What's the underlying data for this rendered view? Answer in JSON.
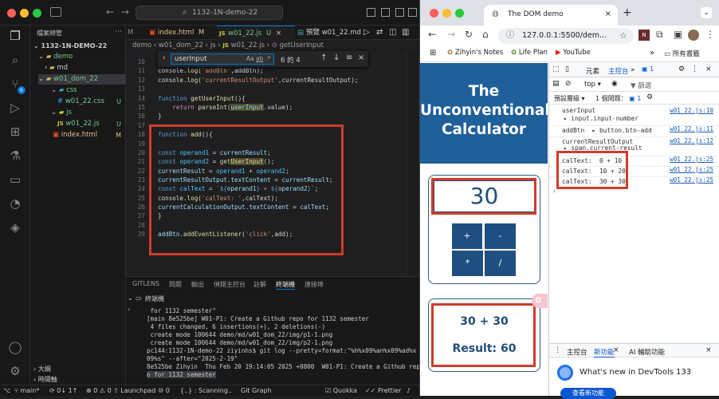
{
  "vscode": {
    "command_center": "1132-1N-demo-22",
    "explorer": {
      "title": "檔案總管",
      "root": "1132-1N-DEMO-22",
      "items": [
        {
          "label": "demo",
          "status": "",
          "kind": "folder"
        },
        {
          "label": "md",
          "status": "",
          "kind": "folder"
        },
        {
          "label": "w01_dom_22",
          "status": "",
          "kind": "folder"
        },
        {
          "label": "css",
          "status": "",
          "kind": "folder"
        },
        {
          "label": "w01_22.css",
          "status": "U",
          "kind": "file"
        },
        {
          "label": "js",
          "status": "",
          "kind": "folder"
        },
        {
          "label": "w01_22.js",
          "status": "U",
          "kind": "file"
        },
        {
          "label": "index.html",
          "status": "M",
          "kind": "file"
        }
      ],
      "outline": "大綱",
      "timeline": "時間軸"
    },
    "tabs": [
      {
        "label": "index.html",
        "status": "M"
      },
      {
        "label": "w01_22.js",
        "status": "U"
      },
      {
        "label": "預覽 w01_22.md",
        "status": ""
      }
    ],
    "breadcrumb": [
      "demo",
      "w01_dom_22",
      "js",
      "w01_22.js",
      "getUserInput"
    ],
    "find": {
      "query": "userInput",
      "opt_case": "Aa",
      "opt_word": "ab",
      "opt_regex": ".*",
      "count": "6 的 4"
    },
    "code_lines": [
      {
        "n": "10",
        "text": "console.log('addBtn',addBtn);"
      },
      {
        "n": "11",
        "text": "console.log('currentResultOutput',currentResultOutput);"
      },
      {
        "n": "12",
        "text": ""
      },
      {
        "n": "13",
        "text": "function getUserInput(){"
      },
      {
        "n": "14",
        "text": "    return parseInt(userInput.value);"
      },
      {
        "n": "15",
        "text": "}"
      },
      {
        "n": "16",
        "text": ""
      },
      {
        "n": "17",
        "text": ""
      },
      {
        "n": "18",
        "text": "function add(){"
      },
      {
        "n": "19",
        "text": ""
      },
      {
        "n": "20",
        "text": "const operand1 = currentResult;"
      },
      {
        "n": "21",
        "text": "const operand2 = getUserInput();"
      },
      {
        "n": "22",
        "text": "currentResult = operand1 + operand2;"
      },
      {
        "n": "23",
        "text": "currentResultOutput.textContent = currentResult;"
      },
      {
        "n": "24",
        "text": "const calText = `${operand1} + ${operand2}`;"
      },
      {
        "n": "25",
        "text": "console.log('calText: ',calText);"
      },
      {
        "n": "26",
        "text": "currentCalculationOutput.textContent = calText;"
      },
      {
        "n": "27",
        "text": "}"
      },
      {
        "n": "28",
        "text": ""
      },
      {
        "n": "29",
        "text": "addBtn.addEventListener('click',add);"
      }
    ],
    "panel": {
      "tabs": [
        "GITLENS",
        "問題",
        "輸出",
        "偵錯主控台",
        "註解",
        "終端機",
        "連接埠"
      ],
      "active_tab": "終端機",
      "terminal_title": "終端機",
      "lines": [
        " for 1132 semester\"",
        "[main 8e525be] W01-P1: Create a Github repo for 1132 semester",
        " 4 files changed, 6 insertions(+), 2 deletions(-)",
        " create mode 100644 demo/md/w01_dom_22/img/p1-1.png",
        " create mode 100644 demo/md/w01_dom_22/img/p2-1.png",
        "pc144:1132-1N-demo-22 ziyinhs$ git log --pretty=format:\"%h%x09%an%x09%ad%x",
        "09%s\" --after=\"2025-2-19\"",
        "8e525be Zihyin  Thu Feb 20 19:14:05 2025 +0800  W01-P1: Create a Github repo",
        "o for 1132 semester",
        "f61a6f5 Zihyin  Thu Feb 20 18:58:25 2025 +0800  first commit",
        "pc144:1132-1N-demo-22 ziyinhs$ "
      ]
    },
    "statusbar": {
      "branch": "main*",
      "sync": "0↓ 1↑",
      "problems": "⊗ 0 ⚠ 0",
      "launchpad": "Launchpad",
      "ports": "⑩ 0",
      "scanning": "{..} : Scanning..",
      "gitgraph": "Git Graph",
      "quokka": "Quokka",
      "prettier": "Prettier"
    }
  },
  "chrome": {
    "tab_title": "The DOM demo",
    "url": "127.0.0.1:5500/dem...",
    "bookmarks": [
      "Zihyin's Notes",
      "Life Plan",
      "YouTube",
      "所有書籤"
    ],
    "page": {
      "title_lines": [
        "The",
        "Unconventional",
        "Calculator"
      ],
      "display_value": "30",
      "buttons": [
        "+",
        "-",
        "*",
        "/"
      ],
      "calculation": "30 + 30",
      "result": "Result: 60"
    },
    "devtools": {
      "tabs": [
        "元素",
        "主控台"
      ],
      "active_tab": "主控台",
      "issues_badge": "1",
      "context": "top",
      "filter_placeholder": "篩選",
      "level": "預設層級",
      "issues_text": "1 個問題：",
      "issues_count": "1",
      "logs": [
        {
          "label": "userInput",
          "detail": "▸ input.input-number",
          "source": "w01_22.js:10"
        },
        {
          "label": "addBtn  ▸ button.btn-add",
          "detail": "",
          "source": "w01_22.js:11"
        },
        {
          "label": "currentResultOutput",
          "detail": "▸ span.current-result",
          "source": "w01_22.js:12"
        },
        {
          "label": "calText:  0 + 10",
          "detail": "",
          "source": "w01_22.js:25"
        },
        {
          "label": "calText:  10 + 20",
          "detail": "",
          "source": "w01_22.js:25"
        },
        {
          "label": "calText:  30 + 30",
          "detail": "",
          "source": "w01_22.js:25"
        }
      ],
      "drawer_tabs": [
        "主控台",
        "新功能",
        "AI 輔助功能"
      ],
      "drawer_active": "新功能",
      "whats_new": "What's new in DevTools 133",
      "whats_new_button": "查看新功能"
    }
  }
}
